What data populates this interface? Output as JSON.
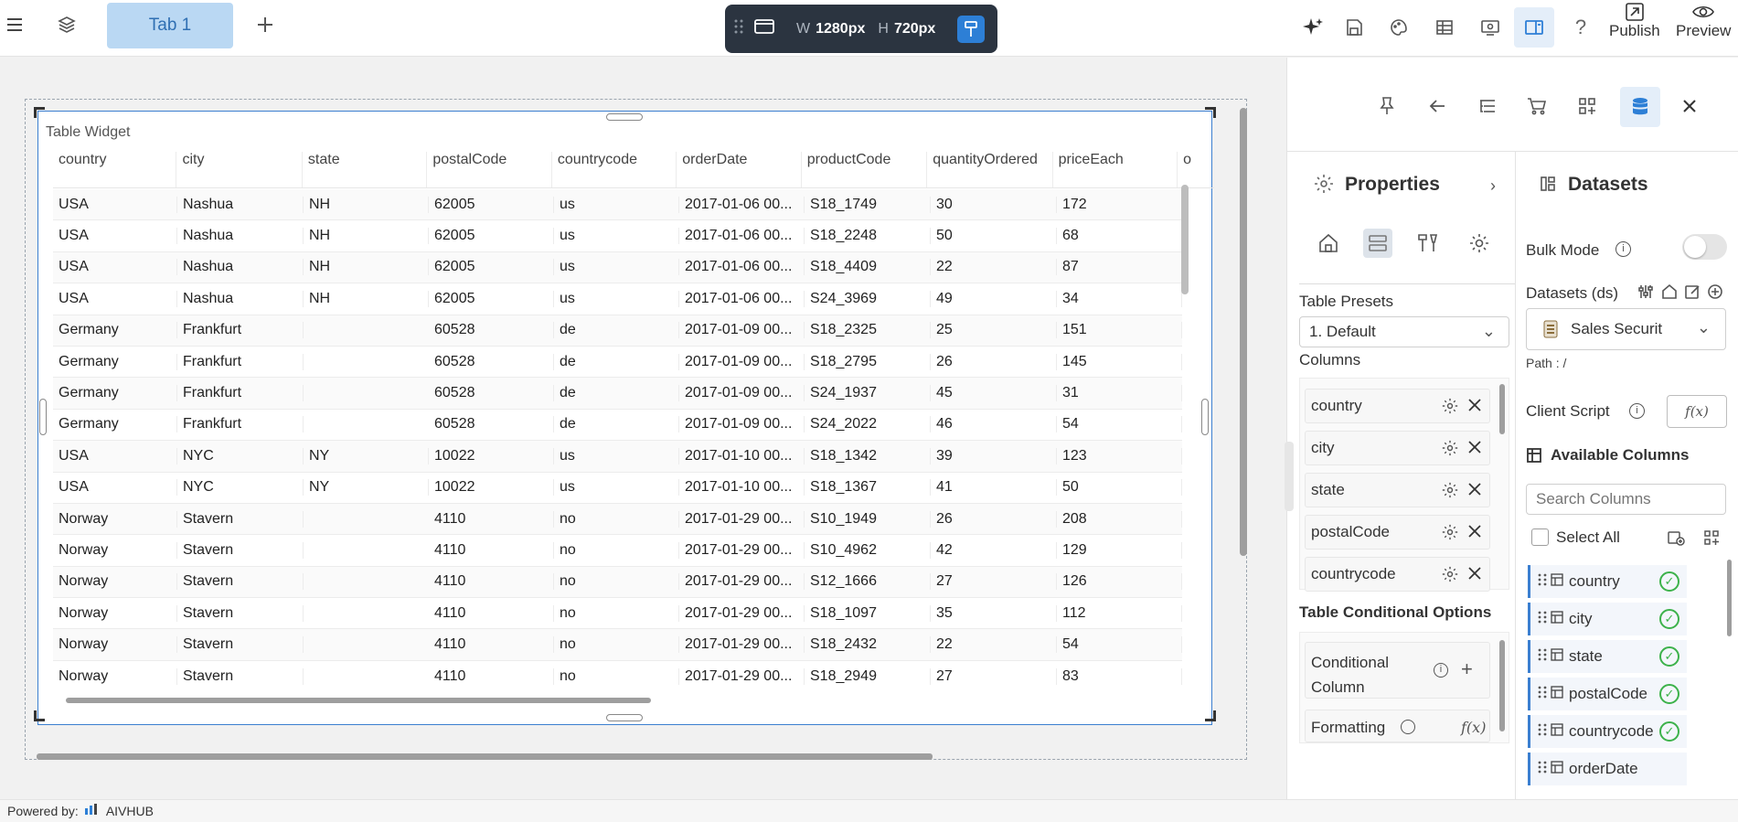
{
  "toolbar": {
    "tab_label": "Tab 1",
    "width_label": "W",
    "width_value": "1280px",
    "height_label": "H",
    "height_value": "720px",
    "publish_label": "Publish",
    "preview_label": "Preview"
  },
  "widget": {
    "title": "Table Widget",
    "columns": [
      "country",
      "city",
      "state",
      "postalCode",
      "countrycode",
      "orderDate",
      "productCode",
      "quantityOrdered",
      "priceEach",
      "o"
    ],
    "rows": [
      [
        "USA",
        "Nashua",
        "NH",
        "62005",
        "us",
        "2017-01-06 00...",
        "S18_1749",
        "30",
        "172"
      ],
      [
        "USA",
        "Nashua",
        "NH",
        "62005",
        "us",
        "2017-01-06 00...",
        "S18_2248",
        "50",
        "68"
      ],
      [
        "USA",
        "Nashua",
        "NH",
        "62005",
        "us",
        "2017-01-06 00...",
        "S18_4409",
        "22",
        "87"
      ],
      [
        "USA",
        "Nashua",
        "NH",
        "62005",
        "us",
        "2017-01-06 00...",
        "S24_3969",
        "49",
        "34"
      ],
      [
        "Germany",
        "Frankfurt",
        "",
        "60528",
        "de",
        "2017-01-09 00...",
        "S18_2325",
        "25",
        "151"
      ],
      [
        "Germany",
        "Frankfurt",
        "",
        "60528",
        "de",
        "2017-01-09 00...",
        "S18_2795",
        "26",
        "145"
      ],
      [
        "Germany",
        "Frankfurt",
        "",
        "60528",
        "de",
        "2017-01-09 00...",
        "S24_1937",
        "45",
        "31"
      ],
      [
        "Germany",
        "Frankfurt",
        "",
        "60528",
        "de",
        "2017-01-09 00...",
        "S24_2022",
        "46",
        "54"
      ],
      [
        "USA",
        "NYC",
        "NY",
        "10022",
        "us",
        "2017-01-10 00...",
        "S18_1342",
        "39",
        "123"
      ],
      [
        "USA",
        "NYC",
        "NY",
        "10022",
        "us",
        "2017-01-10 00...",
        "S18_1367",
        "41",
        "50"
      ],
      [
        "Norway",
        "Stavern",
        "",
        "4110",
        "no",
        "2017-01-29 00...",
        "S10_1949",
        "26",
        "208"
      ],
      [
        "Norway",
        "Stavern",
        "",
        "4110",
        "no",
        "2017-01-29 00...",
        "S10_4962",
        "42",
        "129"
      ],
      [
        "Norway",
        "Stavern",
        "",
        "4110",
        "no",
        "2017-01-29 00...",
        "S12_1666",
        "27",
        "126"
      ],
      [
        "Norway",
        "Stavern",
        "",
        "4110",
        "no",
        "2017-01-29 00...",
        "S18_1097",
        "35",
        "112"
      ],
      [
        "Norway",
        "Stavern",
        "",
        "4110",
        "no",
        "2017-01-29 00...",
        "S18_2432",
        "22",
        "54"
      ],
      [
        "Norway",
        "Stavern",
        "",
        "4110",
        "no",
        "2017-01-29 00...",
        "S18_2949",
        "27",
        "83"
      ]
    ]
  },
  "properties": {
    "title": "Properties",
    "table_presets_label": "Table Presets",
    "preset_value": "1. Default",
    "columns_label": "Columns",
    "columns": [
      "country",
      "city",
      "state",
      "postalCode",
      "countrycode"
    ],
    "conditional_options_label": "Table Conditional Options",
    "conditional_column_label": "Conditional Column",
    "formatting_label": "Formatting",
    "fx_label": "f(x)"
  },
  "datasets": {
    "title": "Datasets",
    "bulk_mode_label": "Bulk Mode",
    "datasets_label": "Datasets (ds)",
    "dataset_value": "Sales Securit",
    "path_label": "Path : /",
    "client_script_label": "Client Script",
    "fx_label": "f(x)",
    "available_columns_label": "Available Columns",
    "search_placeholder": "Search Columns",
    "select_all_label": "Select All",
    "available_columns": [
      "country",
      "city",
      "state",
      "postalCode",
      "countrycode",
      "orderDate"
    ]
  },
  "footer": {
    "powered_label": "Powered by:",
    "brand": "AIVHUB"
  }
}
